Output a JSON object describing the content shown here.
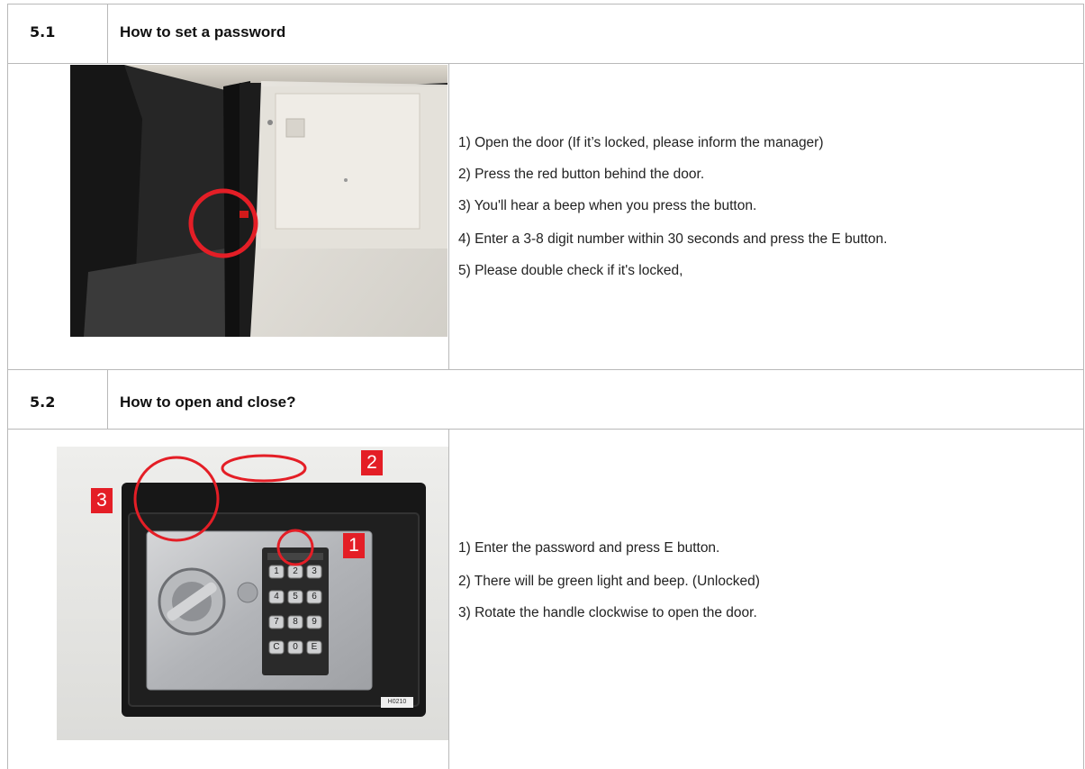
{
  "sections": [
    {
      "number": "5.1",
      "title": "How to set a password",
      "steps": [
        "1) Open the door (If it’s locked, please inform the manager)",
        "2) Press the red button behind the door.",
        "3) You'll hear a beep when you press the button.",
        "4) Enter a 3-8 digit number within 30 seconds and press the E button.",
        "5) Please double check if it's locked,"
      ]
    },
    {
      "number": "5.2",
      "title": "How to open and close?",
      "steps": [
        "1) Enter the password and press E button.",
        "2) There will be green light and beep. (Unlocked)",
        "3) Rotate the handle clockwise to open the door."
      ],
      "callouts": [
        "1",
        "2",
        "3"
      ],
      "keypad_keys": [
        "1",
        "2",
        "3",
        "4",
        "5",
        "6",
        "7",
        "8",
        "9",
        "C",
        "0",
        "E"
      ],
      "safe_label": "H0210"
    }
  ],
  "colors": {
    "annotation_red": "#e41e26",
    "grid_line": "#b9b9b9"
  }
}
